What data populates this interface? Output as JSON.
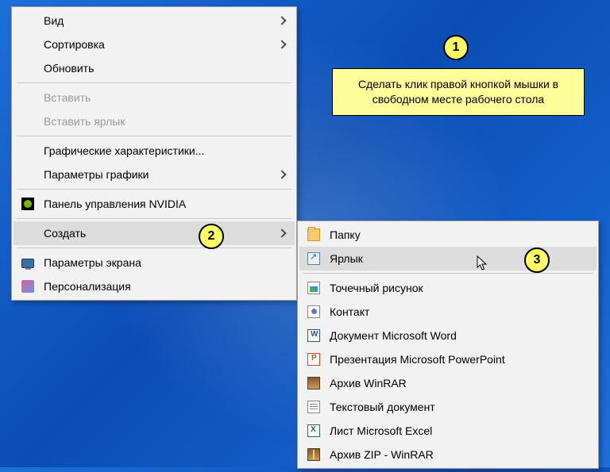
{
  "callouts": {
    "b1": "1",
    "b2": "2",
    "b3": "3",
    "tip": "Сделать клик правой кнопкой мышки в свободном месте рабочего стола"
  },
  "primary": [
    {
      "key": "view",
      "label": "Вид",
      "arrow": true
    },
    {
      "key": "sort",
      "label": "Сортировка",
      "arrow": true
    },
    {
      "key": "refresh",
      "label": "Обновить"
    },
    {
      "sep": true
    },
    {
      "key": "paste",
      "label": "Вставить",
      "disabled": true
    },
    {
      "key": "paste-shortcut",
      "label": "Вставить ярлык",
      "disabled": true
    },
    {
      "sep": true
    },
    {
      "key": "gfx-props",
      "label": "Графические характеристики..."
    },
    {
      "key": "gfx-params",
      "label": "Параметры графики",
      "arrow": true
    },
    {
      "sep": true
    },
    {
      "key": "nvidia",
      "label": "Панель управления NVIDIA",
      "icon": "nvidia"
    },
    {
      "sep": true
    },
    {
      "key": "create",
      "label": "Создать",
      "arrow": true,
      "hover": true
    },
    {
      "sep": true
    },
    {
      "key": "display-settings",
      "label": "Параметры экрана",
      "icon": "display"
    },
    {
      "key": "personalize",
      "label": "Персонализация",
      "icon": "personal"
    }
  ],
  "submenu": [
    {
      "key": "folder",
      "label": "Папку",
      "icon": "folder"
    },
    {
      "key": "shortcut",
      "label": "Ярлык",
      "icon": "shortcut",
      "hover": true
    },
    {
      "sep": true
    },
    {
      "key": "bmp",
      "label": "Точечный рисунок",
      "icon": "bmp"
    },
    {
      "key": "contact",
      "label": "Контакт",
      "icon": "contact"
    },
    {
      "key": "word",
      "label": "Документ Microsoft Word",
      "icon": "word"
    },
    {
      "key": "ppt",
      "label": "Презентация Microsoft PowerPoint",
      "icon": "ppt"
    },
    {
      "key": "rar",
      "label": "Архив WinRAR",
      "icon": "rar"
    },
    {
      "key": "txt",
      "label": "Текстовый документ",
      "icon": "txt"
    },
    {
      "key": "xls",
      "label": "Лист Microsoft Excel",
      "icon": "xls"
    },
    {
      "key": "zip",
      "label": "Архив ZIP - WinRAR",
      "icon": "zip"
    }
  ]
}
